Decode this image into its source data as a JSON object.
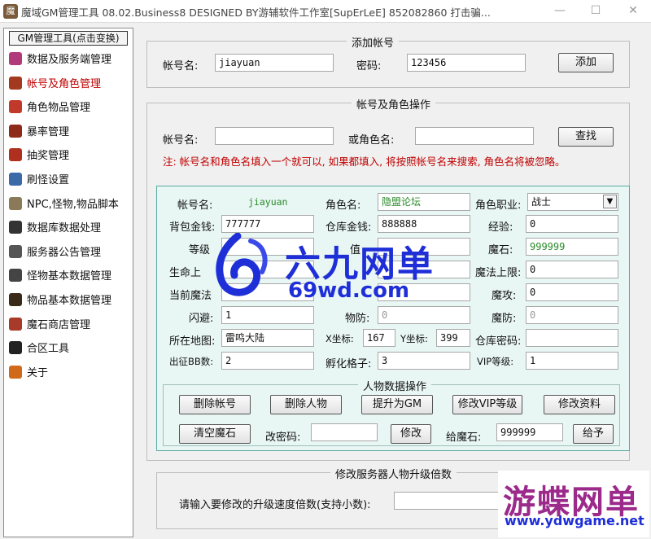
{
  "window": {
    "title": "魔域GM管理工具 08.02.Business8 DESIGNED BY游辅软件工作室[SupErLeE] 852082860 打击骗...",
    "icon": "app-icon"
  },
  "sidebar": {
    "header": "GM管理工具(点击变换)",
    "items": [
      {
        "label": "数据及服务端管理",
        "icon": "database-icon",
        "color": "#b03a7a"
      },
      {
        "label": "帐号及角色管理",
        "icon": "user-icon",
        "color": "#a33a1f"
      },
      {
        "label": "角色物品管理",
        "icon": "item-icon",
        "color": "#c0392b"
      },
      {
        "label": "暴率管理",
        "icon": "rate-icon",
        "color": "#8e2a1a"
      },
      {
        "label": "抽奖管理",
        "icon": "lottery-icon",
        "color": "#b03020"
      },
      {
        "label": "刷怪设置",
        "icon": "monster-spawn-icon",
        "color": "#3a6aa8"
      },
      {
        "label": "NPC,怪物,物品脚本",
        "icon": "script-icon",
        "color": "#8a7a5a"
      },
      {
        "label": "数据库数据处理",
        "icon": "db-process-icon",
        "color": "#333333"
      },
      {
        "label": "服务器公告管理",
        "icon": "announce-icon",
        "color": "#555555"
      },
      {
        "label": "怪物基本数据管理",
        "icon": "monster-data-icon",
        "color": "#444444"
      },
      {
        "label": "物品基本数据管理",
        "icon": "item-data-icon",
        "color": "#3a2a1a"
      },
      {
        "label": "魔石商店管理",
        "icon": "shop-icon",
        "color": "#a83a2a"
      },
      {
        "label": "合区工具",
        "icon": "merge-icon",
        "color": "#222222"
      },
      {
        "label": "关于",
        "icon": "about-icon",
        "color": "#d06a1a"
      }
    ]
  },
  "add_account": {
    "title": "添加帐号",
    "account_label": "帐号名:",
    "account_value": "jiayuan",
    "password_label": "密码:",
    "password_value": "123456",
    "add_button": "添加"
  },
  "account_ops": {
    "title": "帐号及角色操作",
    "account_label": "帐号名:",
    "account_value": "",
    "role_label": "或角色名:",
    "role_value": "",
    "search_button": "查找",
    "notice": "注: 帐号名和角色名填入一个就可以, 如果都填入, 将按照帐号名来搜索, 角色名将被忽略。"
  },
  "detail": {
    "account_label": "帐号名:",
    "account_value": "jiayuan",
    "role_label": "角色名:",
    "role_value": "隐盟论坛",
    "job_label": "角色职业:",
    "job_value": "战士",
    "bag_money_label": "背包金钱:",
    "bag_money_value": "777777",
    "store_money_label": "仓库金钱:",
    "store_money_value": "888888",
    "exp_label": "经验:",
    "exp_value": "0",
    "level_label": "等级",
    "level_value_partial": "值",
    "magic_stone_label": "魔石:",
    "magic_stone_value": "999999",
    "hp_label": "生命上",
    "mp_max_label": "魔法上限:",
    "mp_max_value": "0",
    "cur_mp_label": "当前魔法",
    "magic_atk_label": "魔攻:",
    "magic_atk_value": "0",
    "dodge_label": "闪避:",
    "dodge_value": "1",
    "phys_def_label": "物防:",
    "phys_def_value": "0",
    "magic_def_label": "魔防:",
    "magic_def_value": "0",
    "map_label": "所在地图:",
    "map_value": "雷鸣大陆",
    "x_label": "X坐标:",
    "x_value": "167",
    "y_label": "Y坐标:",
    "y_value": "399",
    "store_pwd_label": "仓库密码:",
    "store_pwd_value": "",
    "bb_label": "出征BB数:",
    "bb_value": "2",
    "hatch_label": "孵化格子:",
    "hatch_value": "3",
    "vip_label": "VIP等级:",
    "vip_value": "1",
    "ops_title": "人物数据操作",
    "btn_delete_account": "删除帐号",
    "btn_delete_role": "删除人物",
    "btn_promote_gm": "提升为GM",
    "btn_modify_vip": "修改VIP等级",
    "btn_modify_info": "修改资料",
    "btn_clear_stone": "清空魔石",
    "change_pwd_label": "改密码:",
    "change_pwd_value": "",
    "btn_modify": "修改",
    "give_stone_label": "给魔石:",
    "give_stone_value": "999999",
    "btn_give": "给予"
  },
  "upgrade": {
    "title": "修改服务器人物升级倍数",
    "prompt": "请输入要修改的升级速度倍数(支持小数):",
    "value": ""
  },
  "watermarks": {
    "site1_text": "六九网单",
    "site1_url": "69wd.com",
    "site2_text": "游蝶网单",
    "site2_url": "www.ydwgame.net"
  },
  "colors": {
    "accent_red": "#c00000",
    "detail_bg": "#e8f6f4",
    "detail_border": "#5aa99f",
    "watermark_blue": "#1f2fd8",
    "watermark_purple": "#9b2a8b"
  }
}
